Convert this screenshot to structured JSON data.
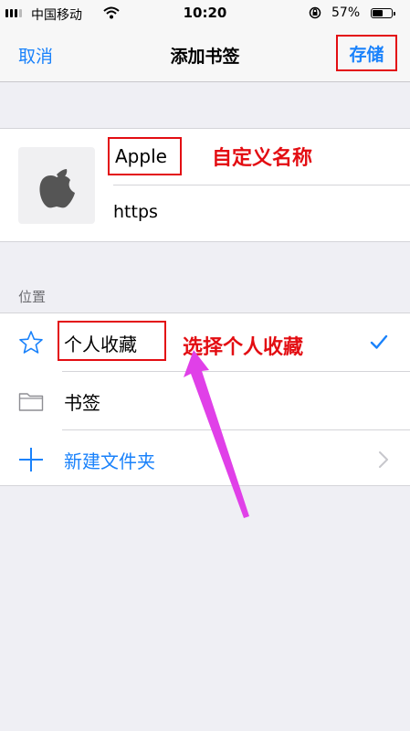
{
  "status_bar": {
    "carrier": "中国移动",
    "time": "10:20",
    "battery": "57%",
    "battery_level": 0.57
  },
  "nav": {
    "cancel_label": "取消",
    "title": "添加书签",
    "save_label": "存储"
  },
  "bookmark": {
    "name_value": "Apple",
    "url_value": "https",
    "thumbnail_icon": "apple-logo-icon"
  },
  "annotations": {
    "custom_name": "自定义名称",
    "choose_favorites": "选择个人收藏",
    "color": "#e30d12"
  },
  "location": {
    "section_header": "位置",
    "items": [
      {
        "label": "个人收藏",
        "icon": "star-icon",
        "selected": true
      },
      {
        "label": "书签",
        "icon": "folder-icon",
        "selected": false
      },
      {
        "label": "新建文件夹",
        "icon": "plus-icon",
        "selected": false
      }
    ]
  },
  "colors": {
    "accent": "#1a82fb",
    "annotation": "#e30d12",
    "background": "#efeff4",
    "arrow": "#e040e8"
  }
}
